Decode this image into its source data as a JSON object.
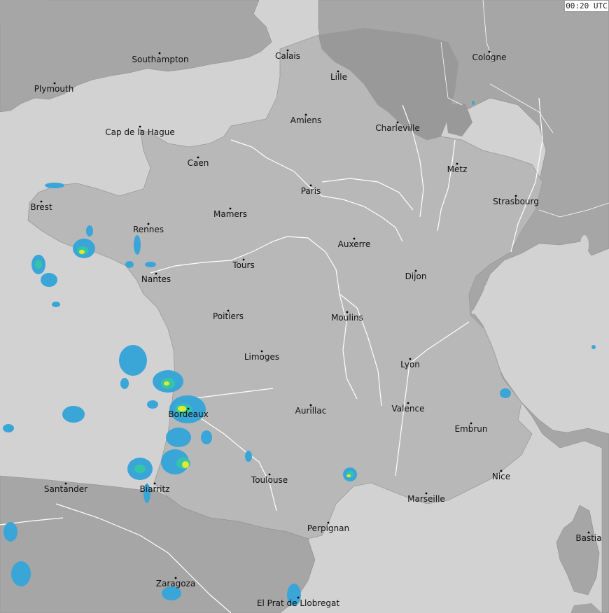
{
  "map": {
    "timestamp": "00:20 UTC",
    "colors": {
      "sea": "#d2d2d2",
      "land_france": "#b8b8b8",
      "land_neighbors": "#a6a6a6",
      "land_dark": "#999999",
      "rivers": "#ffffff",
      "radar_light": "#3aa6d8",
      "radar_medium": "#34c6a4",
      "radar_heavy": "#e6e633"
    },
    "cities": [
      {
        "id": "southampton",
        "name": "Southampton"
      },
      {
        "id": "plymouth",
        "name": "Plymouth"
      },
      {
        "id": "calais",
        "name": "Calais"
      },
      {
        "id": "lille",
        "name": "Lille"
      },
      {
        "id": "cologne",
        "name": "Cologne"
      },
      {
        "id": "amiens",
        "name": "Amiens"
      },
      {
        "id": "charleville",
        "name": "Charleville"
      },
      {
        "id": "cap-de-la-hague",
        "name": "Cap de la Hague"
      },
      {
        "id": "caen",
        "name": "Caen"
      },
      {
        "id": "metz",
        "name": "Metz"
      },
      {
        "id": "paris",
        "name": "Paris"
      },
      {
        "id": "brest",
        "name": "Brest"
      },
      {
        "id": "strasbourg",
        "name": "Strasbourg"
      },
      {
        "id": "mamers",
        "name": "Mamers"
      },
      {
        "id": "rennes",
        "name": "Rennes"
      },
      {
        "id": "auxerre",
        "name": "Auxerre"
      },
      {
        "id": "tours",
        "name": "Tours"
      },
      {
        "id": "dijon",
        "name": "Dijon"
      },
      {
        "id": "nantes",
        "name": "Nantes"
      },
      {
        "id": "poitiers",
        "name": "Poitiers"
      },
      {
        "id": "moulins",
        "name": "Moulins"
      },
      {
        "id": "limoges",
        "name": "Limoges"
      },
      {
        "id": "lyon",
        "name": "Lyon"
      },
      {
        "id": "valence",
        "name": "Valence"
      },
      {
        "id": "bordeaux",
        "name": "Bordeaux"
      },
      {
        "id": "aurillac",
        "name": "Aurillac"
      },
      {
        "id": "embrun",
        "name": "Embrun"
      },
      {
        "id": "nice",
        "name": "Nice"
      },
      {
        "id": "toulouse",
        "name": "Toulouse"
      },
      {
        "id": "santander",
        "name": "Santander"
      },
      {
        "id": "biarritz",
        "name": "Biarritz"
      },
      {
        "id": "marseille",
        "name": "Marseille"
      },
      {
        "id": "perpignan",
        "name": "Perpignan"
      },
      {
        "id": "bastia",
        "name": "Bastia"
      },
      {
        "id": "zaragoza",
        "name": "Zaragoza"
      },
      {
        "id": "el-prat",
        "name": "El Prat de Llobregat"
      }
    ]
  }
}
